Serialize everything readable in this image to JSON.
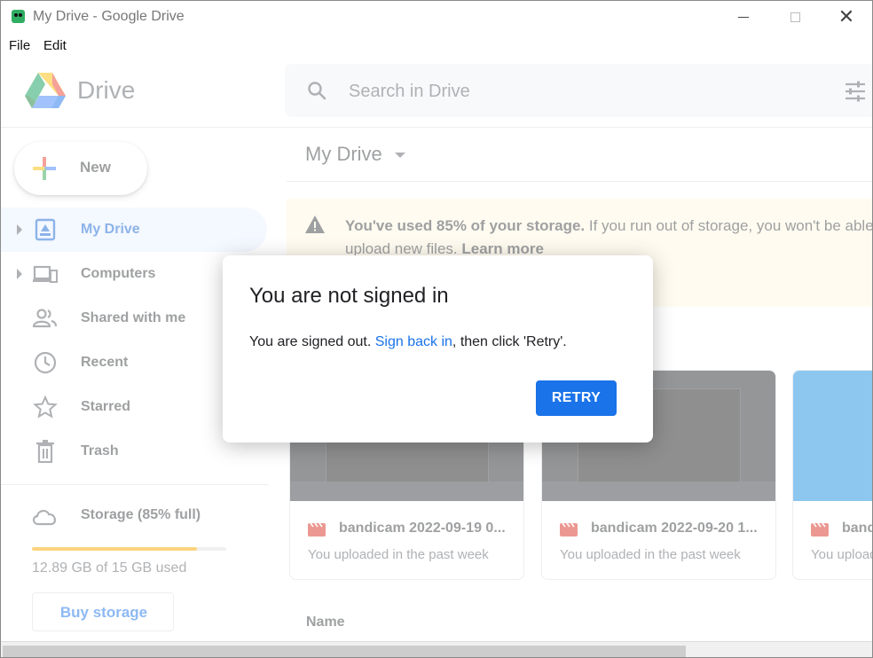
{
  "window": {
    "title": "My Drive - Google Drive",
    "menu": [
      "File",
      "Edit"
    ],
    "controls": {
      "minimize": "—",
      "maximize": "□",
      "close": "✕"
    }
  },
  "header": {
    "logo_text": "Drive",
    "search_placeholder": "Search in Drive"
  },
  "sidebar": {
    "new_label": "New",
    "items": [
      {
        "label": "My Drive",
        "icon": "my-drive-icon",
        "active": true,
        "expandable": true
      },
      {
        "label": "Computers",
        "icon": "computers-icon",
        "active": false,
        "expandable": true
      },
      {
        "label": "Shared with me",
        "icon": "shared-icon",
        "active": false,
        "expandable": false
      },
      {
        "label": "Recent",
        "icon": "clock-icon",
        "active": false,
        "expandable": false
      },
      {
        "label": "Starred",
        "icon": "star-icon",
        "active": false,
        "expandable": false
      },
      {
        "label": "Trash",
        "icon": "trash-icon",
        "active": false,
        "expandable": false
      }
    ],
    "storage": {
      "label": "Storage (85% full)",
      "used_text": "12.89 GB of 15 GB used",
      "fill_fraction": 0.85,
      "buy_label": "Buy storage"
    }
  },
  "main": {
    "title": "My Drive",
    "banner": {
      "bold": "You've used 85% of your storage.",
      "text": " If you run out of storage, you won't be able to",
      "line2": "upload new files. ",
      "link": "Learn more"
    },
    "cards": [
      {
        "name": "bandicam 2022-09-19 0...",
        "sub": "You uploaded in the past week"
      },
      {
        "name": "bandicam 2022-09-20 1...",
        "sub": "You uploaded in the past week"
      },
      {
        "name": "band",
        "sub": "You upload"
      }
    ],
    "list_header": "Name"
  },
  "dialog": {
    "title": "You are not signed in",
    "body_prefix": "You are signed out. ",
    "body_link": "Sign back in",
    "body_suffix": ", then click 'Retry'.",
    "button": "RETRY"
  },
  "colors": {
    "accent": "#1a73e8",
    "active_nav_bg": "#e8f0fe",
    "warning_banner_bg": "#fef7e0",
    "storage_bar": "#f9ab00"
  }
}
